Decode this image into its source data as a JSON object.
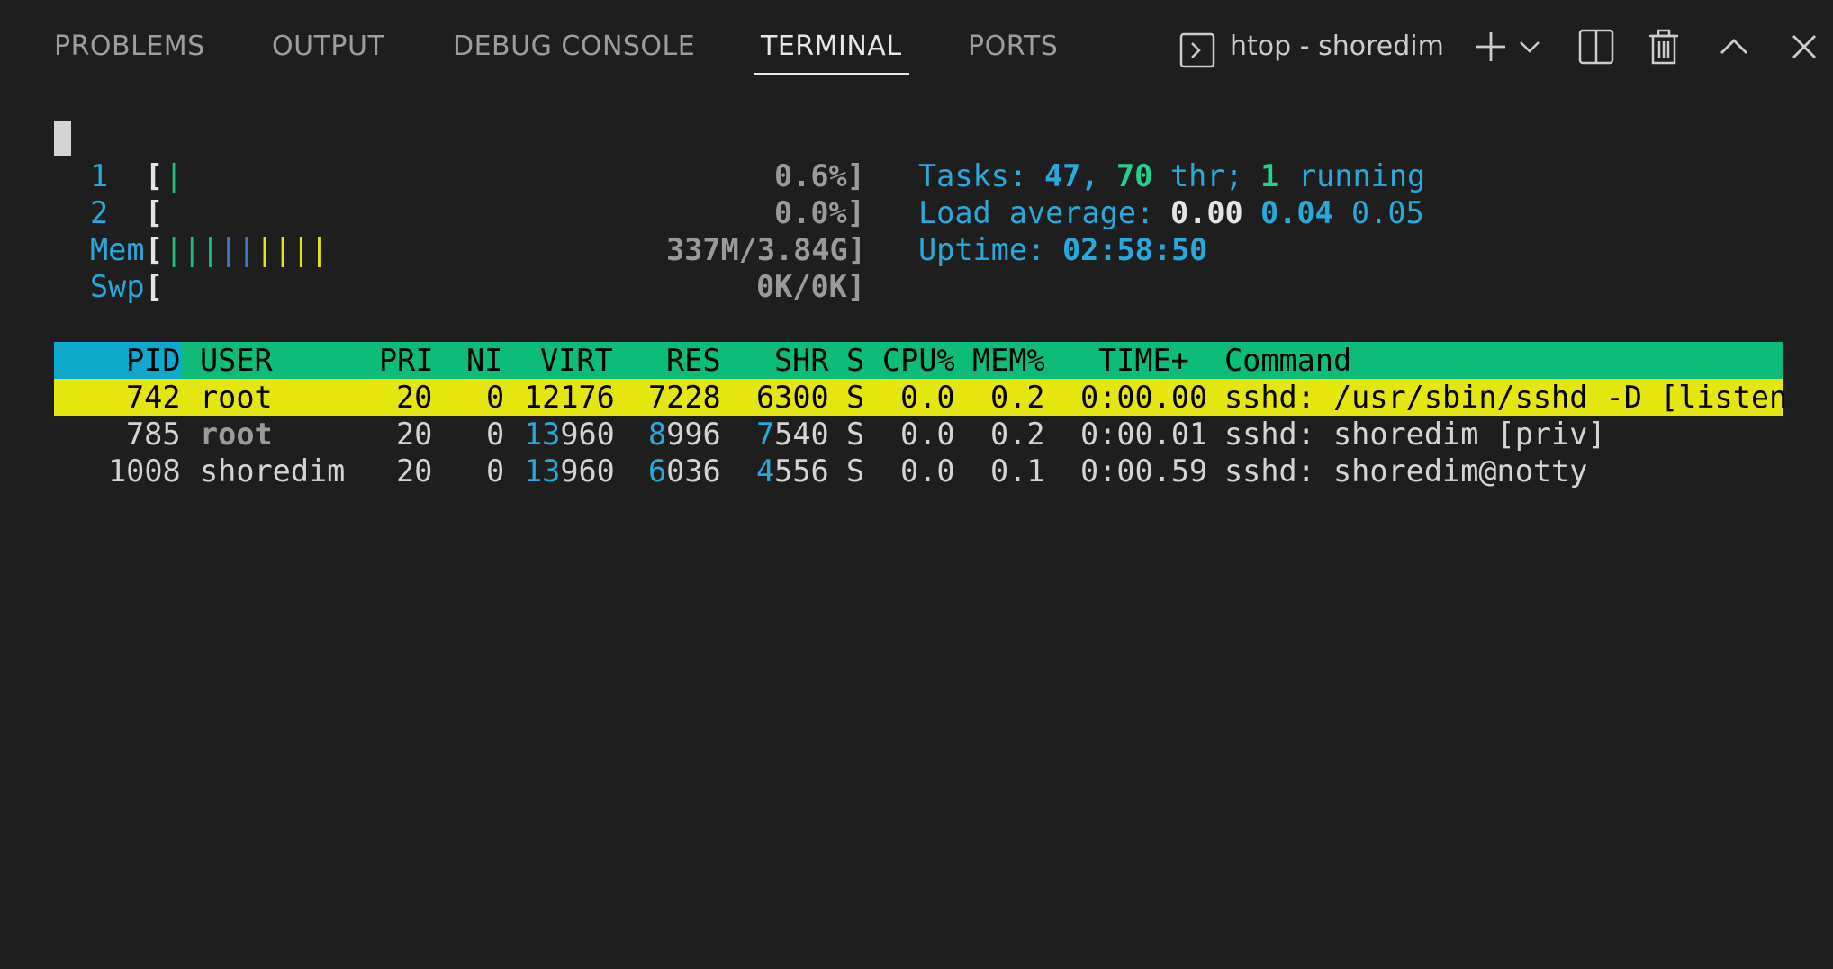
{
  "panel": {
    "tabs": [
      {
        "label": "PROBLEMS",
        "active": false
      },
      {
        "label": "OUTPUT",
        "active": false
      },
      {
        "label": "DEBUG CONSOLE",
        "active": false
      },
      {
        "label": "TERMINAL",
        "active": true
      },
      {
        "label": "PORTS",
        "active": false
      }
    ],
    "terminal_title": "htop - shoredim"
  },
  "htop": {
    "cpu": [
      {
        "id": "1",
        "bar": "|",
        "value": "0.6%]"
      },
      {
        "id": "2",
        "bar": "",
        "value": "0.0%]"
      }
    ],
    "mem": {
      "label": "Mem",
      "value": "337M/3.84G]"
    },
    "swp": {
      "label": "Swp",
      "value": "0K/0K]"
    },
    "tasks": {
      "label": "Tasks:",
      "count": "47,",
      "threads": "70",
      "thr_label": "thr;",
      "running": "1",
      "running_label": "running"
    },
    "load": {
      "label": "Load average:",
      "one": "0.00",
      "five": "0.04",
      "fifteen": "0.05"
    },
    "uptime": {
      "label": "Uptime:",
      "value": "02:58:50"
    },
    "columns": [
      "PID",
      "USER",
      "PRI",
      "NI",
      "VIRT",
      "RES",
      "SHR",
      "S",
      "CPU%",
      "MEM%",
      "TIME+",
      "Command"
    ],
    "processes": [
      {
        "pid": "742",
        "user": "root",
        "pri": "20",
        "ni": "0",
        "virt": "12176",
        "res": "7228",
        "shr": "6300",
        "s": "S",
        "cpu": "0.0",
        "mem": "0.2",
        "time": "0:00.00",
        "command": "sshd: /usr/sbin/sshd -D [listen"
      },
      {
        "pid": "785",
        "user": "root",
        "pri": "20",
        "ni": "0",
        "virt_hi": "13",
        "virt_lo": "960",
        "res_hi": "8",
        "res_lo": "996",
        "shr_hi": "7",
        "shr_lo": "540",
        "s": "S",
        "cpu": "0.0",
        "mem": "0.2",
        "time": "0:00.01",
        "command": "sshd: shoredim [priv]"
      },
      {
        "pid": "1008",
        "user": "shoredim",
        "pri": "20",
        "ni": "0",
        "virt_hi": "13",
        "virt_lo": "960",
        "res_hi": "6",
        "res_lo": "036",
        "shr_hi": "4",
        "shr_lo": "556",
        "s": "S",
        "cpu": "0.0",
        "mem": "0.1",
        "time": "0:00.59",
        "command": "sshd: shoredim@notty"
      }
    ]
  },
  "colors": {
    "cyan": "#29a8db",
    "green": "#0dbc79",
    "yellow": "#e5e510",
    "background": "#1e1e1e"
  }
}
